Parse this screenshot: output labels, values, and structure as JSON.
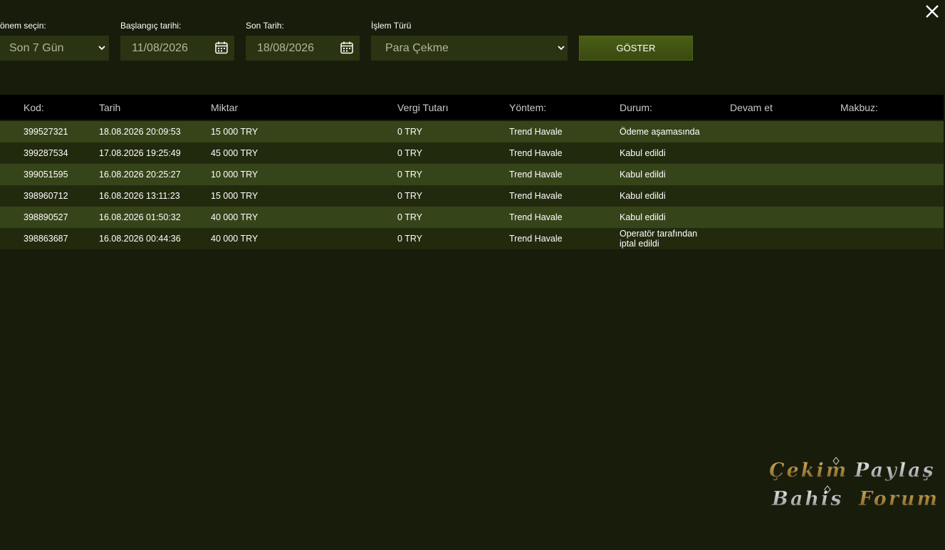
{
  "filters": {
    "period_label": "önem seçin:",
    "period_value": "Son 7 Gün",
    "start_label": "Başlangıç tarihi:",
    "start_value": "11/08/2026",
    "end_label": "Son Tarih:",
    "end_value": "18/08/2026",
    "type_label": "İşlem Türü",
    "type_value": "Para Çekme",
    "show_label": "GÖSTER"
  },
  "table": {
    "headers": [
      "Kod:",
      "Tarih",
      "Miktar",
      "Vergi Tutarı",
      "Yöntem:",
      "Durum:",
      "Devam et",
      "Makbuz:"
    ],
    "rows": [
      {
        "code": "399527321",
        "date": "18.08.2026 20:09:53",
        "amount": "15 000 TRY",
        "tax": "0 TRY",
        "method": "Trend Havale",
        "status": "Ödeme aşamasında"
      },
      {
        "code": "399287534",
        "date": "17.08.2026 19:25:49",
        "amount": "45 000 TRY",
        "tax": "0 TRY",
        "method": "Trend Havale",
        "status": "Kabul edildi"
      },
      {
        "code": "399051595",
        "date": "16.08.2026 20:25:27",
        "amount": "10 000 TRY",
        "tax": "0 TRY",
        "method": "Trend Havale",
        "status": "Kabul edildi"
      },
      {
        "code": "398960712",
        "date": "16.08.2026 13:11:23",
        "amount": "15 000 TRY",
        "tax": "0 TRY",
        "method": "Trend Havale",
        "status": "Kabul edildi"
      },
      {
        "code": "398890527",
        "date": "16.08.2026 01:50:32",
        "amount": "40 000 TRY",
        "tax": "0 TRY",
        "method": "Trend Havale",
        "status": "Kabul edildi"
      },
      {
        "code": "398863687",
        "date": "16.08.2026 00:44:36",
        "amount": "40 000 TRY",
        "tax": "0 TRY",
        "method": "Trend Havale",
        "status": "Operatör tarafından iptal edildi"
      }
    ]
  },
  "watermark": {
    "line1": "ÇekimPaylaş",
    "line2": "Bahis Forum"
  },
  "colors": {
    "background": "#181c0b",
    "row_odd": "#36441a",
    "row_even": "#222a0e",
    "field_bg": "#2b3412",
    "button_bg": "#4a5e16"
  }
}
